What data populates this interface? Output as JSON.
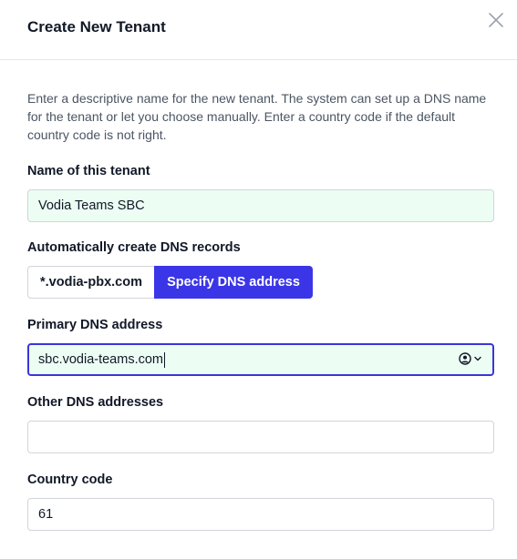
{
  "dialog": {
    "title": "Create New Tenant",
    "description": "Enter a descriptive name for the new tenant. The system can set up a DNS name for the tenant or let you choose manually. Enter a country code if the default country code is not right."
  },
  "fields": {
    "tenant_name_label": "Name of this tenant",
    "tenant_name_value": "Vodia Teams SBC",
    "auto_dns_label": "Automatically create DNS records",
    "dns_option_wildcard": "*.vodia-pbx.com",
    "dns_option_specify": "Specify DNS address",
    "primary_dns_label": "Primary DNS address",
    "primary_dns_value": "sbc.vodia-teams.com",
    "other_dns_label": "Other DNS addresses",
    "other_dns_value": "",
    "country_code_label": "Country code",
    "country_code_value": "61"
  },
  "icons": {
    "close": "close-icon",
    "autofill": "user-circle-icon",
    "dropdown": "chevron-down-icon"
  },
  "colors": {
    "accent": "#3b35e8",
    "filled_bg": "#ecfdf3"
  }
}
